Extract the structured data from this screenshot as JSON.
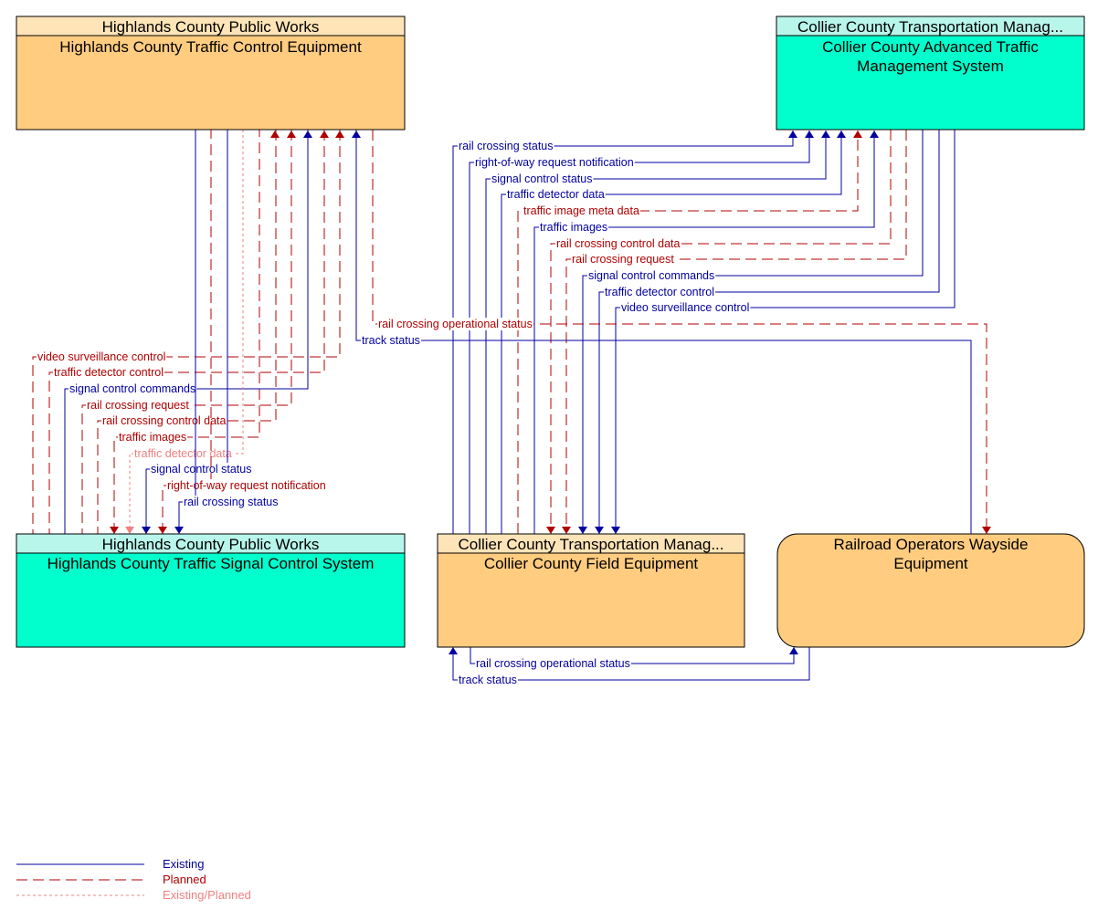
{
  "colors": {
    "existing": "#0000A0",
    "planned": "#B00000",
    "existing_planned": "#F08080",
    "equipment_fill": "#FFCC80",
    "equipment_header": "#FFE4B8",
    "center_fill": "#00FFCC",
    "center_header": "#B8F5EA",
    "border": "#000000"
  },
  "nodes": {
    "hc_tce": {
      "header": "Highlands County Public Works",
      "title": [
        "Highlands County Traffic Control Equipment"
      ]
    },
    "cc_atms": {
      "header": "Collier County Transportation Manag...",
      "title": [
        "Collier County Advanced Traffic",
        "Management System"
      ]
    },
    "hc_tscs": {
      "header": "Highlands County Public Works",
      "title": [
        "Highlands County Traffic Signal Control System"
      ]
    },
    "cc_fe": {
      "header": "Collier County Transportation Manag...",
      "title": [
        "Collier County Field Equipment"
      ]
    },
    "rr_we": {
      "title": [
        "Railroad Operators Wayside",
        "Equipment"
      ]
    }
  },
  "flows": {
    "hc_to_hcs": [
      {
        "label": "video surveillance control",
        "status": "planned"
      },
      {
        "label": "traffic detector control",
        "status": "planned"
      },
      {
        "label": "signal control commands",
        "status": "existing"
      },
      {
        "label": "rail crossing request",
        "status": "planned"
      },
      {
        "label": "rail crossing control data",
        "status": "planned"
      }
    ],
    "hcs_to_hc": [
      {
        "label": "traffic images",
        "status": "planned"
      },
      {
        "label": "traffic detector data",
        "status": "existing_planned"
      },
      {
        "label": "signal control status",
        "status": "existing"
      },
      {
        "label": "right-of-way request notification",
        "status": "planned"
      },
      {
        "label": "rail crossing status",
        "status": "existing"
      }
    ],
    "fe_to_atms": [
      {
        "label": "rail crossing status",
        "status": "existing"
      },
      {
        "label": "right-of-way request notification",
        "status": "existing"
      },
      {
        "label": "signal control status",
        "status": "existing"
      },
      {
        "label": "traffic detector data",
        "status": "existing"
      },
      {
        "label": "traffic image meta data",
        "status": "planned"
      },
      {
        "label": "traffic images",
        "status": "existing"
      }
    ],
    "atms_to_fe": [
      {
        "label": "rail crossing control data",
        "status": "planned"
      },
      {
        "label": "rail crossing request",
        "status": "planned"
      },
      {
        "label": "signal control commands",
        "status": "existing"
      },
      {
        "label": "traffic detector control",
        "status": "existing"
      },
      {
        "label": "video surveillance control",
        "status": "existing"
      }
    ],
    "hc_rr": [
      {
        "label": "rail crossing operational status",
        "status": "planned"
      },
      {
        "label": "track status",
        "status": "existing"
      }
    ],
    "fe_rr": [
      {
        "label": "rail crossing operational status",
        "status": "existing"
      },
      {
        "label": "track status",
        "status": "existing"
      }
    ]
  },
  "legend": [
    {
      "label": "Existing",
      "status": "existing"
    },
    {
      "label": "Planned",
      "status": "planned"
    },
    {
      "label": "Existing/Planned",
      "status": "existing_planned"
    }
  ]
}
